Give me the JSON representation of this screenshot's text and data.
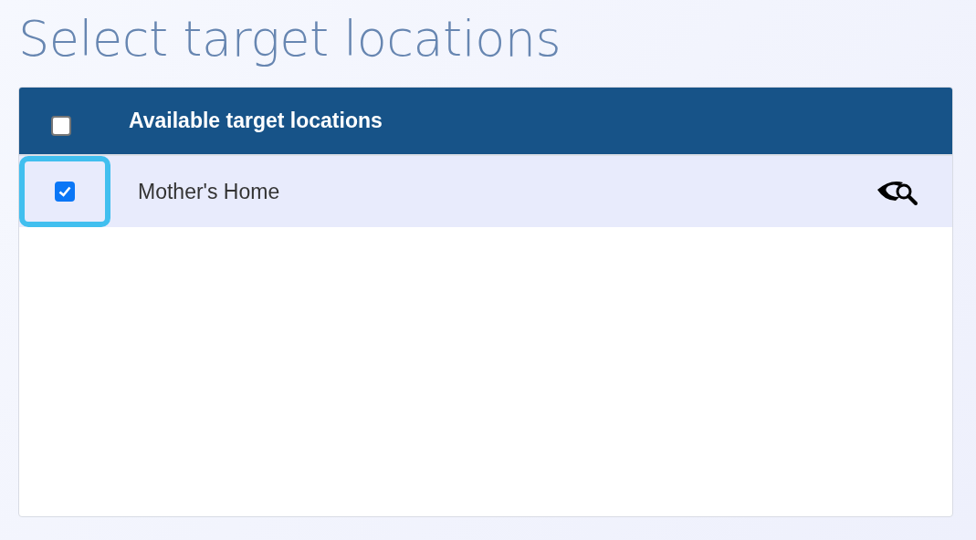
{
  "title": "Select target locations",
  "table": {
    "select_all": {
      "checked": false
    },
    "header": "Available target locations",
    "rows": [
      {
        "name": "Mother's Home",
        "checked": true,
        "focused": true
      }
    ]
  }
}
